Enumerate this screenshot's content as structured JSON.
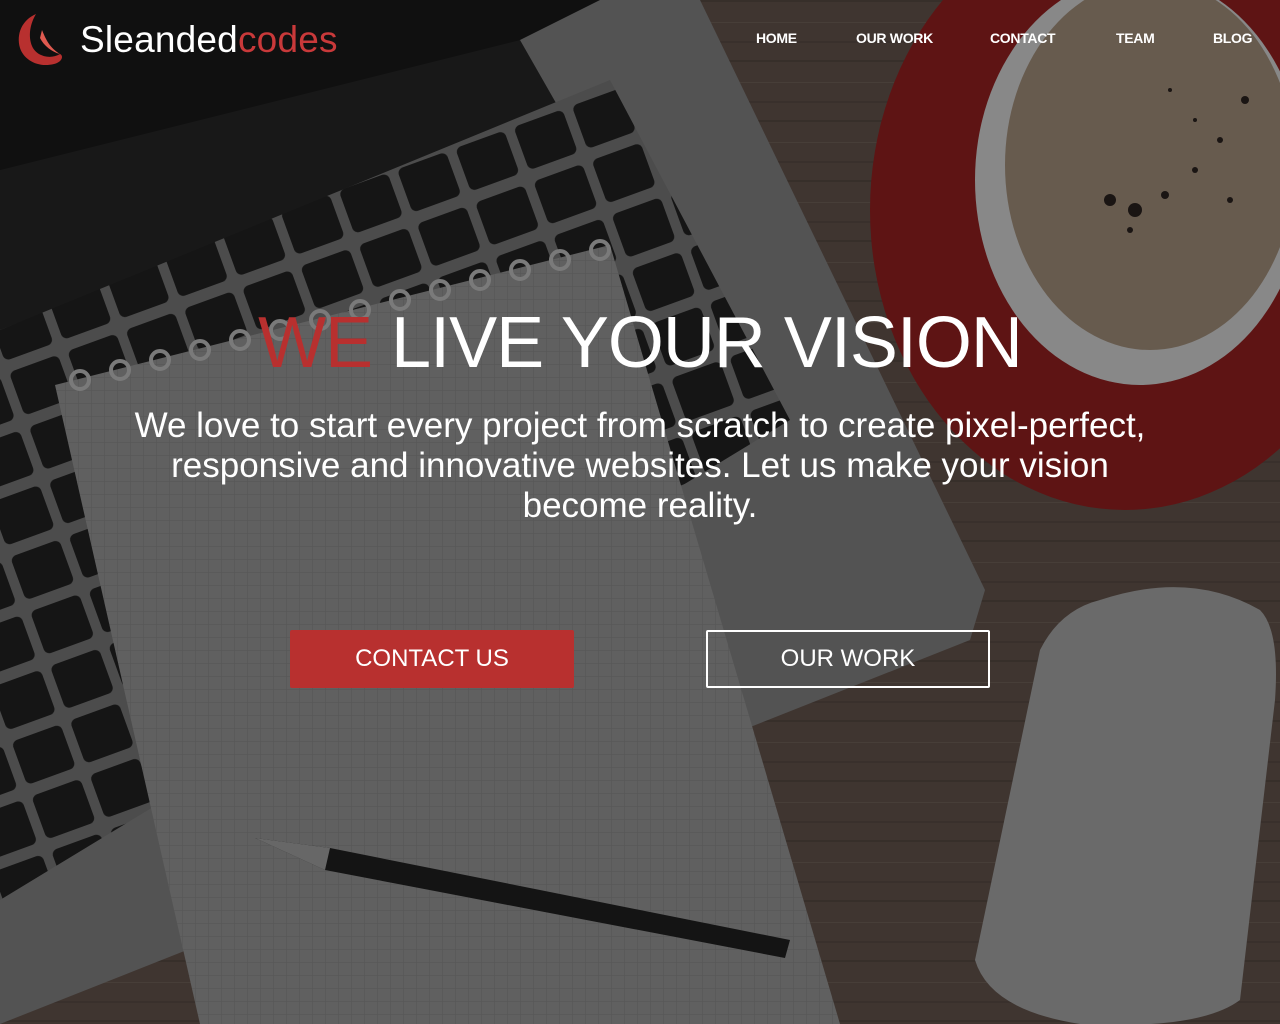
{
  "brand": {
    "name_main": "Sleanded",
    "name_accent": "codes",
    "accent_color": "#c9393a"
  },
  "nav": {
    "items": [
      {
        "label": "HOME"
      },
      {
        "label": "OUR WORK"
      },
      {
        "label": "CONTACT"
      },
      {
        "label": "TEAM"
      },
      {
        "label": "BLOG"
      }
    ]
  },
  "hero": {
    "title_accent": "WE",
    "title_rest": " LIVE YOUR VISION",
    "subtitle": "We love to start every project from scratch to create pixel-perfect, responsive and innovative websites. Let us make your vision become reality.",
    "primary_button": "CONTACT US",
    "secondary_button": "OUR WORK",
    "button_color": "#b8302f"
  },
  "icons": {
    "logo": "crescent-wing-logo-icon"
  }
}
